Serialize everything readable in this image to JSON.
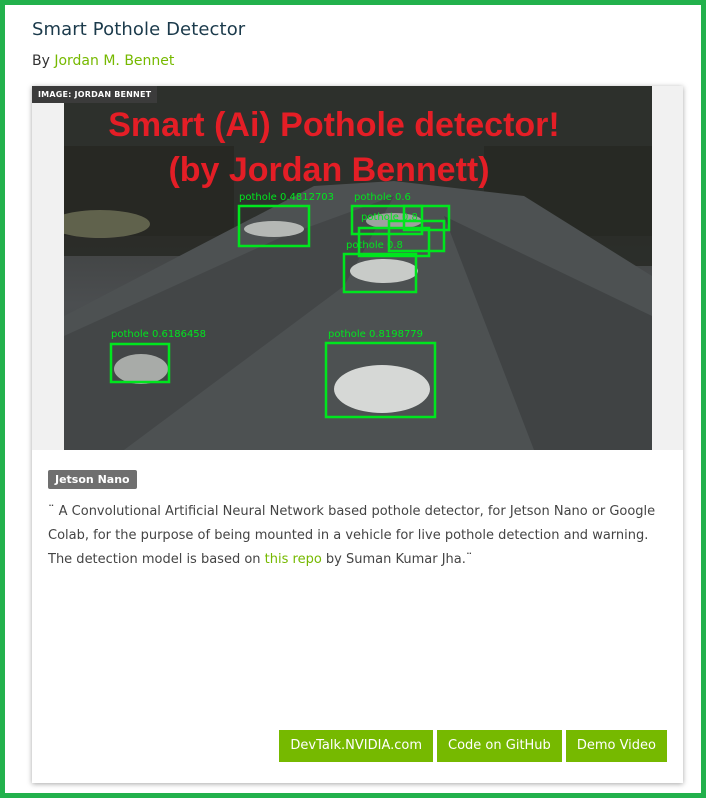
{
  "page": {
    "title": "Smart Pothole Detector",
    "byline_prefix": "By ",
    "author": "Jordan M. Bennet"
  },
  "image": {
    "credit": "IMAGE: JORDAN BENNET",
    "headline_line1": "Smart (Ai) Pothole detector!",
    "headline_line2": "(by Jordan Bennett)",
    "detections": [
      {
        "label": "pothole 0.4812703"
      },
      {
        "label": "pothole 0.6"
      },
      {
        "label": "pothole 0.8"
      },
      {
        "label": "pothole 0.8"
      },
      {
        "label": "pothole 0.6186458"
      },
      {
        "label": "pothole 0.8198779"
      }
    ]
  },
  "tag": "Jetson Nano",
  "description": {
    "part1": "¨ A Convolutional Artificial Neural Network based pothole detector, for Jetson Nano or Google Colab, for the purpose of being mounted in a vehicle for live pothole detection and warning. The detection model is based on ",
    "link": "this repo",
    "part2": " by Suman Kumar Jha.¨"
  },
  "buttons": {
    "devtalk": "DevTalk.NVIDIA.com",
    "github": "Code on GitHub",
    "demo": "Demo Video"
  },
  "colors": {
    "frame": "#22b14c",
    "accent": "#76b900",
    "headline": "#e41e26",
    "box": "#00e61e"
  }
}
